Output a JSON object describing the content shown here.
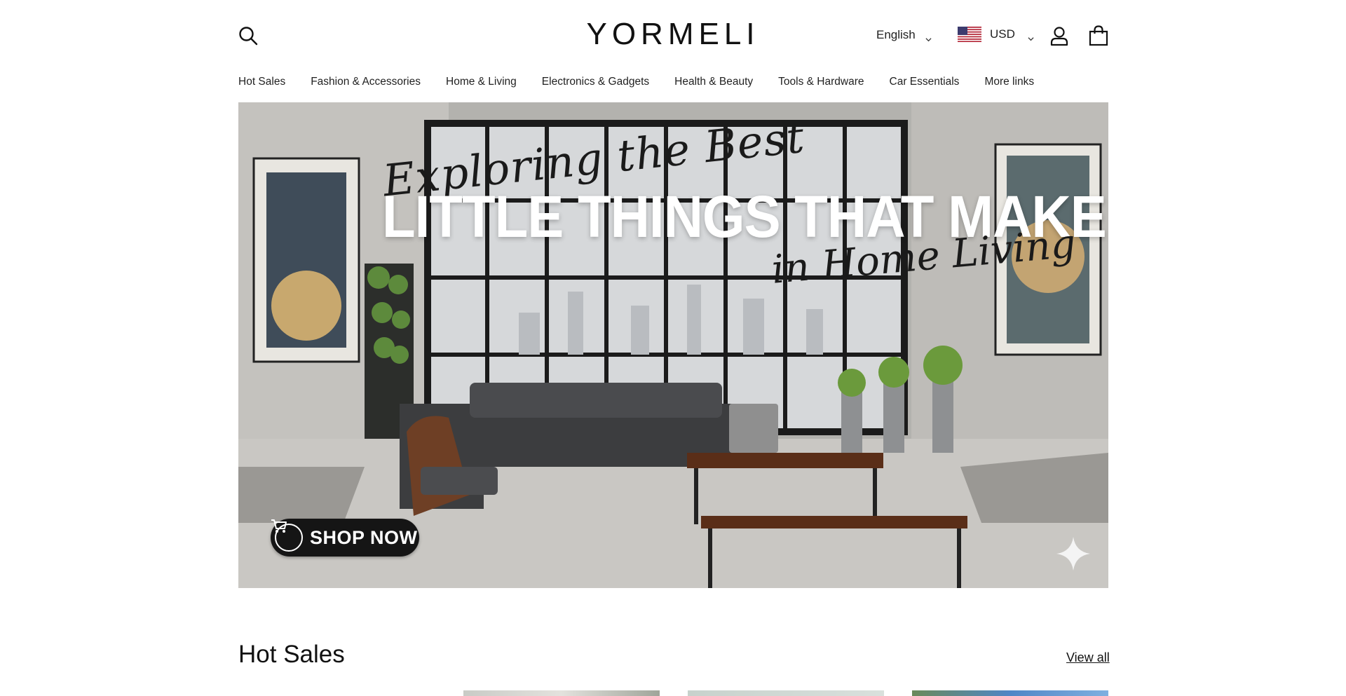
{
  "header": {
    "logo": "YORMELI",
    "language": "English",
    "currency": "USD",
    "icons": {
      "search": "search-icon",
      "account": "user-icon",
      "cart": "shopping-bag-icon",
      "flag": "us-flag-icon",
      "chevron": "chevron-down-icon"
    }
  },
  "nav": {
    "items": [
      "Hot Sales",
      "Fashion & Accessories",
      "Home & Living",
      "Electronics & Gadgets",
      "Health & Beauty",
      "Tools & Hardware",
      "Car Essentials",
      "More links"
    ]
  },
  "hero": {
    "script_top": "Exploring the Best",
    "headline": "LITTLE THINGS THAT MAKE YOU SMILE",
    "script_bottom": "in Home Living",
    "cta": "SHOP NOW"
  },
  "section": {
    "title": "Hot Sales",
    "view_all": "View all"
  },
  "colors": {
    "text": "#111111",
    "cta_bg": "#151515",
    "background": "#ffffff"
  }
}
